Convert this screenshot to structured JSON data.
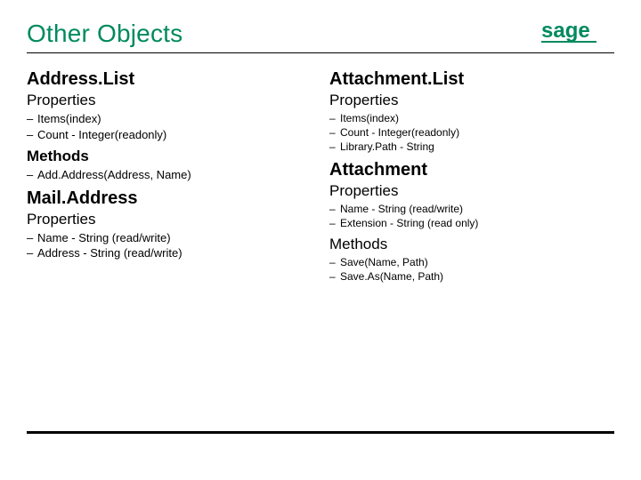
{
  "title": "Other Objects",
  "brand": "sage",
  "colors": {
    "accent": "#008a5e"
  },
  "left": {
    "sections": [
      {
        "heading": "Address.List",
        "groups": [
          {
            "subheading": "Properties",
            "bold": false,
            "items": [
              "Items(index)",
              "Count - Integer(readonly)"
            ]
          },
          {
            "subheading": "Methods",
            "bold": true,
            "items": [
              "Add.Address(Address, Name)"
            ]
          }
        ]
      },
      {
        "heading": "Mail.Address",
        "groups": [
          {
            "subheading": "Properties",
            "bold": false,
            "items": [
              "Name - String (read/write)",
              "Address - String (read/write)"
            ]
          }
        ]
      }
    ]
  },
  "right": {
    "sections": [
      {
        "heading": "Attachment.List",
        "groups": [
          {
            "subheading": "Properties",
            "bold": false,
            "items": [
              "Items(index)",
              "Count - Integer(readonly)",
              "Library.Path - String"
            ]
          }
        ]
      },
      {
        "heading": "Attachment",
        "groups": [
          {
            "subheading": "Properties",
            "bold": false,
            "items": [
              "Name - String (read/write)",
              "Extension - String (read only)"
            ]
          },
          {
            "subheading": "Methods",
            "bold": false,
            "items": [
              "Save(Name, Path)",
              "Save.As(Name, Path)"
            ]
          }
        ]
      }
    ]
  }
}
